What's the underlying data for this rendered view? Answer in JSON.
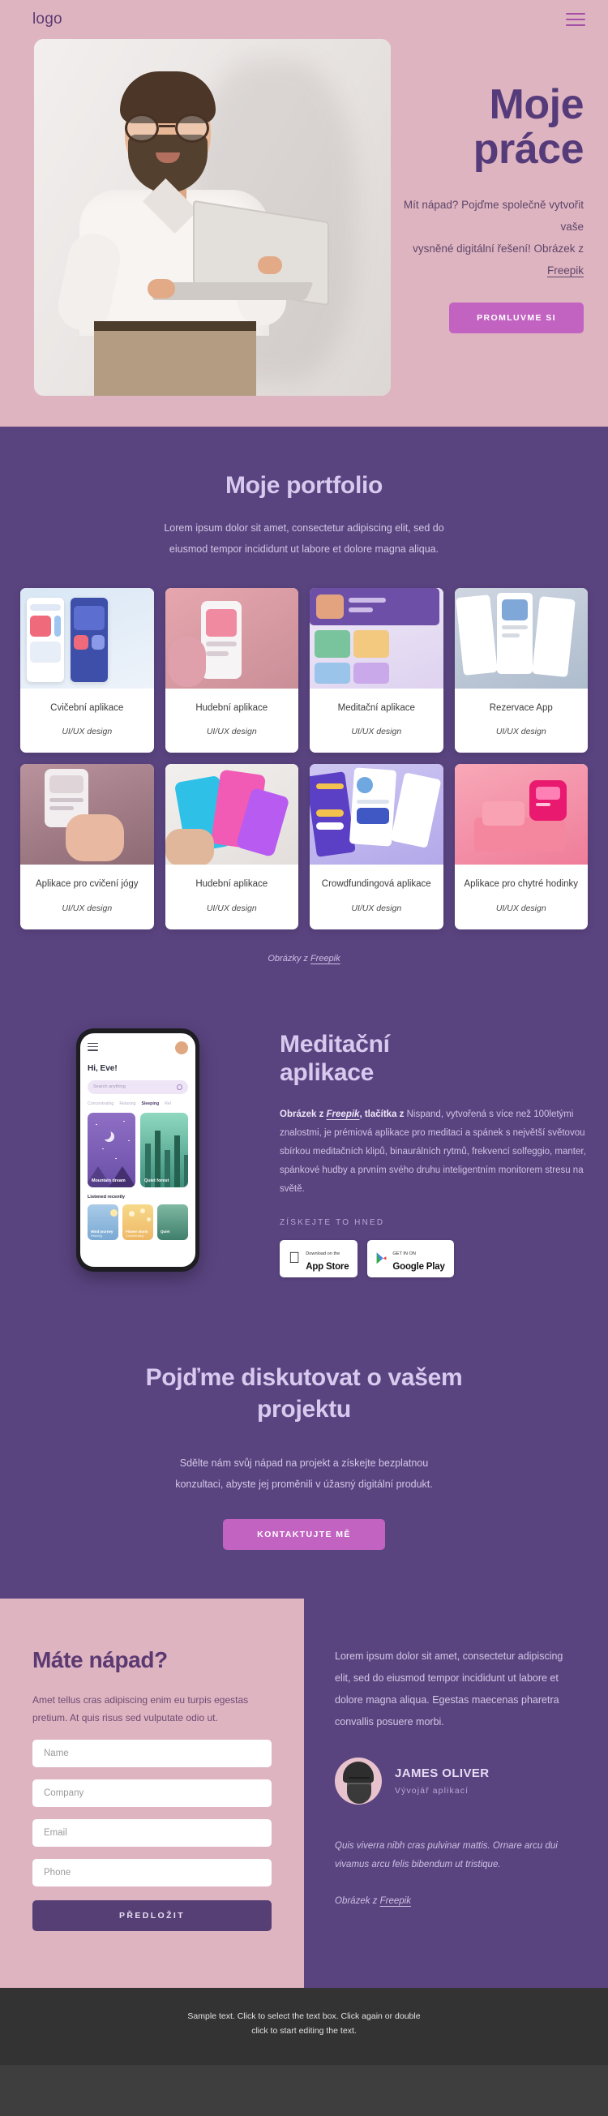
{
  "header": {
    "logo": "logo",
    "menu_icon": "hamburger-menu-icon"
  },
  "hero": {
    "title": "Moje práce",
    "subtitle_line1": "Mít nápad? Pojďme společně vytvořit vaše",
    "subtitle_line2": "vysněné digitální řešení! Obrázek z ",
    "subtitle_link": "Freepik",
    "cta_label": "PROMLUVME SI"
  },
  "portfolio": {
    "title": "Moje portfolio",
    "subtitle_line1": "Lorem ipsum dolor sit amet, consectetur adipiscing elit, sed do",
    "subtitle_line2": "eiusmod tempor incididunt ut labore et dolore magna aliqua.",
    "cards": [
      {
        "title": "Cvičební aplikace",
        "subtitle": "UI/UX design"
      },
      {
        "title": "Hudební aplikace",
        "subtitle": "UI/UX design"
      },
      {
        "title": "Meditační aplikace",
        "subtitle": "UI/UX design"
      },
      {
        "title": "Rezervace  App",
        "subtitle": "UI/UX design"
      },
      {
        "title": "Aplikace pro cvičení jógy",
        "subtitle": "UI/UX design"
      },
      {
        "title": "Hudební aplikace",
        "subtitle": "UI/UX design"
      },
      {
        "title": "Crowdfundingová aplikace",
        "subtitle": "UI/UX design"
      },
      {
        "title": "Aplikace pro chytré hodinky",
        "subtitle": "UI/UX design"
      }
    ],
    "credit_prefix": "Obrázky z ",
    "credit_link": "Freepik"
  },
  "meditation": {
    "title_line1": "Meditační",
    "title_line2": "aplikace",
    "body_lead": "Obrázek z ",
    "body_link": "Freepik",
    "body_bold": ", tlačítka z ",
    "body_rest": " Nispand, vytvořená s více než 100letými znalostmi, je prémiová aplikace pro meditaci a spánek s největší světovou sbírkou meditačních klipů, binaurálních rytmů, frekvencí solfeggio, manter, spánkové hudby a prvním svého druhu inteligentním monitorem stresu na světě.",
    "kicker": "ZÍSKEJTE TO HNED",
    "store_apple_small": "Download on the",
    "store_apple_big": "App Store",
    "store_google_small": "GET IN ON",
    "store_google_big": "Google Play",
    "phone": {
      "greeting": "Hi, Eve!",
      "search_placeholder": "Search anything",
      "tabs": [
        "Concentrating",
        "Relaxing",
        "Sleeping",
        "Rel"
      ],
      "active_tab": "Sleeping",
      "card1": "Mountain dream",
      "card2": "Quiet forest",
      "recent_label": "Listened recently",
      "mini1_title": "Mind journey",
      "mini1_sub": "Relaxing",
      "mini2_title": "Flower storm",
      "mini2_sub": "Concentrating",
      "mini3_title": "Quiet"
    }
  },
  "cta": {
    "title_line1": "Pojďme diskutovat o vašem",
    "title_line2": "projektu",
    "text_line1": "Sdělte nám svůj nápad na projekt a získejte bezplatnou",
    "text_line2": "konzultaci, abyste jej proměnili v úžasný digitální produkt.",
    "button_label": "KONTAKTUJTE MĚ"
  },
  "contact": {
    "heading": "Máte nápad?",
    "text": "Amet tellus cras adipiscing enim eu turpis egestas pretium. At quis risus sed vulputate odio ut.",
    "fields": [
      {
        "name": "name",
        "placeholder": "Name",
        "value": ""
      },
      {
        "name": "company",
        "placeholder": "Company",
        "value": ""
      },
      {
        "name": "email",
        "placeholder": "Email",
        "value": ""
      },
      {
        "name": "phone",
        "placeholder": "Phone",
        "value": ""
      }
    ],
    "submit_label": "PŘEDLOŽIT",
    "testimonial": "Lorem ipsum dolor sit amet, consectetur adipiscing elit, sed do eiusmod tempor incididunt ut labore et dolore magna aliqua. Egestas maecenas pharetra convallis posuere morbi.",
    "person_name": "JAMES OLIVER",
    "person_role": "Vývojář aplikací",
    "quote": "Quis viverra nibh cras pulvinar mattis. Ornare arcu dui vivamus arcu felis bibendum ut tristique.",
    "credit_prefix": "Obrázek z ",
    "credit_link": "Freepik"
  },
  "footer": {
    "line1": "Sample text. Click to select the text box. Click again or double",
    "line2": "click to start editing the text."
  },
  "colors": {
    "hero_bg": "#dfb4c1",
    "purple_bg": "#5a4480",
    "accent_pink": "#c263c2",
    "heading_purple": "#553b7a",
    "light_lavender": "#d8c9ee",
    "footer_bg": "#333333"
  }
}
